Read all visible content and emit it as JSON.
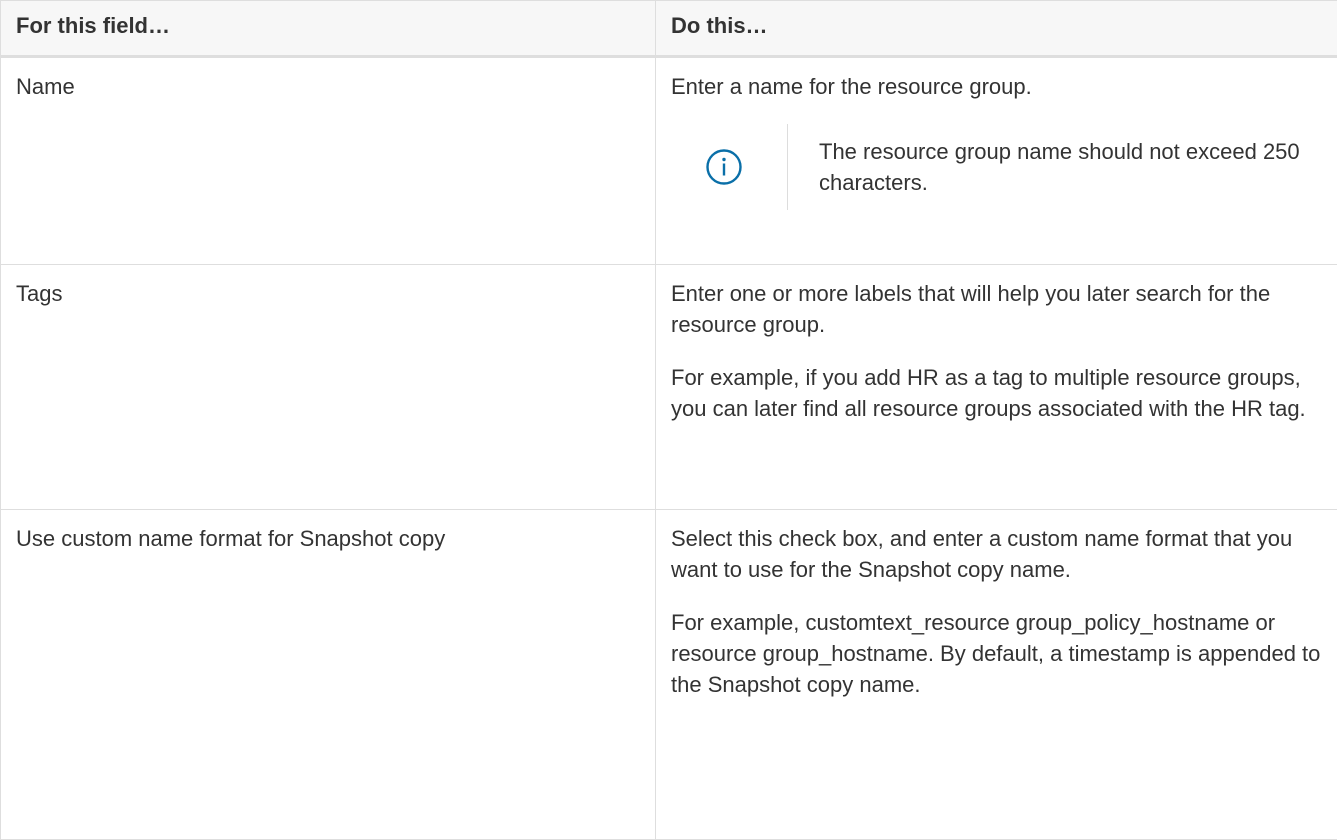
{
  "table": {
    "headers": {
      "field": "For this field…",
      "do": "Do this…"
    },
    "rows": [
      {
        "field": "Name",
        "do": [
          "Enter a name for the resource group."
        ],
        "note": {
          "icon": "info-icon",
          "text": "The resource group name should not exceed 250 characters."
        }
      },
      {
        "field": "Tags",
        "do": [
          "Enter one or more labels that will help you later search for the resource group.",
          "For example, if you add HR as a tag to multiple resource groups, you can later find all resource groups associated with the HR tag."
        ]
      },
      {
        "field": "Use custom name format for Snapshot copy",
        "do": [
          "Select this check box, and enter a custom name format that you want to use for the Snapshot copy name.",
          "For example, customtext_resource group_policy_hostname or resource group_hostname. By default, a timestamp is appended to the Snapshot copy name."
        ]
      }
    ]
  },
  "colors": {
    "text": "#333333",
    "border": "#dedede",
    "header_bg": "#f7f7f7",
    "icon": "#0a6fa8"
  }
}
